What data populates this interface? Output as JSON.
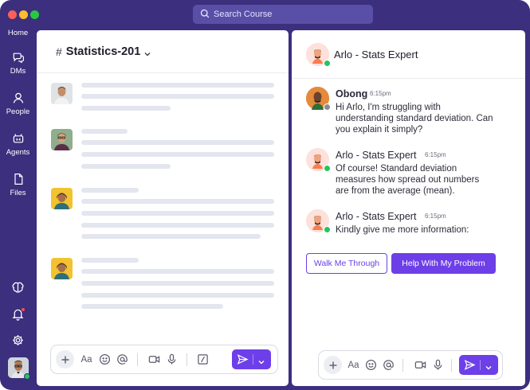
{
  "search": {
    "placeholder": "Search Course"
  },
  "nav": {
    "home": "Home",
    "dms": "DMs",
    "people": "People",
    "agents": "Agents",
    "files": "Files"
  },
  "channel": {
    "hash": "#",
    "name": "Statistics-201"
  },
  "chat": {
    "title": "Arlo - Stats Expert",
    "messages": [
      {
        "author": "Obong",
        "time": "6:15pm",
        "lines": [
          "Hi Arlo, I'm struggling with",
          "understanding standard deviation. Can",
          "you explain it simply?"
        ]
      },
      {
        "author": "Arlo - Stats Expert",
        "time": "6:15pm",
        "lines": [
          "Of course! Standard deviation",
          "measures how spread out numbers",
          "are from the average (mean)."
        ]
      },
      {
        "author": "Arlo - Stats Expert",
        "time": "6:15pm",
        "lines": [
          "Kindly give me more information:"
        ]
      }
    ],
    "actions": {
      "walk": "Walk Me Through",
      "help": "Help With My Problem"
    }
  },
  "composer": {
    "format_label": "Aa"
  },
  "colors": {
    "accent": "#6d3fe8",
    "frame": "#3b2f7e",
    "online": "#22c55e"
  }
}
